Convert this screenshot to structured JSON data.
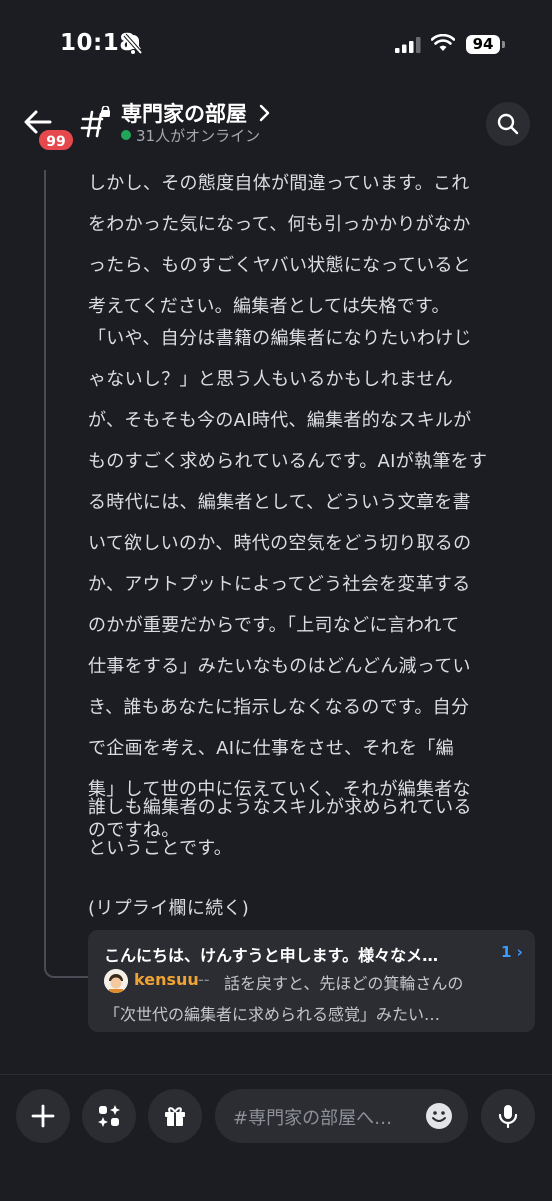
{
  "status_bar": {
    "time": "10:18",
    "battery": "94"
  },
  "header": {
    "unread_badge": "99",
    "channel_name": "専門家の部屋",
    "online_text": "31人がオンライン"
  },
  "message": {
    "paragraph1": [
      "しかし、その態度自体が間違っています。これ",
      "をわかった気になって、何も引っかかりがなか",
      "ったら、ものすごくヤバい状態になっていると",
      "考えてください。編集者としては失格です。"
    ],
    "paragraph2": [
      "「いや、自分は書籍の編集者になりたいわけじ",
      "ゃないし？」と思う人もいるかもしれません",
      "が、そもそも今のAI時代、編集者的なスキルが",
      "ものすごく求められているんです。AIが執筆をす",
      "る時代には、編集者として、どういう文章を書",
      "いて欲しいのか、時代の空気をどう切り取るの",
      "か、アウトプットによってどう社会を変革する",
      "のかが重要だからです。「上司などに言われて",
      "仕事をする」みたいなものはどんどん減ってい",
      "き、誰もあなたに指示しなくなるのです。自分",
      "で企画を考え、AIに仕事をさせ、それを「編",
      "集」して世の中に伝えていく、それが編集者な",
      "のですね。"
    ],
    "paragraph3": [
      "誰しも編集者のようなスキルが求められている",
      "ということです。"
    ],
    "paragraph4": "(リプライ欄に続く)"
  },
  "reply_card": {
    "title": "こんにちは、けんすうと申します。様々なメ…",
    "count": "1",
    "username": "kensuu",
    "separator": "--",
    "preview_line1": "話を戻すと、先ほどの箕輪さんの",
    "preview_line2": "「次世代の編集者に求められる感覚」みたい…"
  },
  "composer": {
    "placeholder": "#専門家の部屋へ…"
  },
  "colors": {
    "background": "#1c1d22",
    "card": "#2b2d33",
    "online": "#23a559",
    "badge": "#e5484d",
    "link": "#3b9cff",
    "username": "#f0a232"
  },
  "icons": [
    "bell-slash-icon",
    "signal-icon",
    "wifi-icon",
    "back-arrow-icon",
    "locked-hash-icon",
    "chevron-right-icon",
    "search-icon",
    "plus-icon",
    "apps-icon",
    "gift-icon",
    "emoji-icon",
    "microphone-icon"
  ]
}
